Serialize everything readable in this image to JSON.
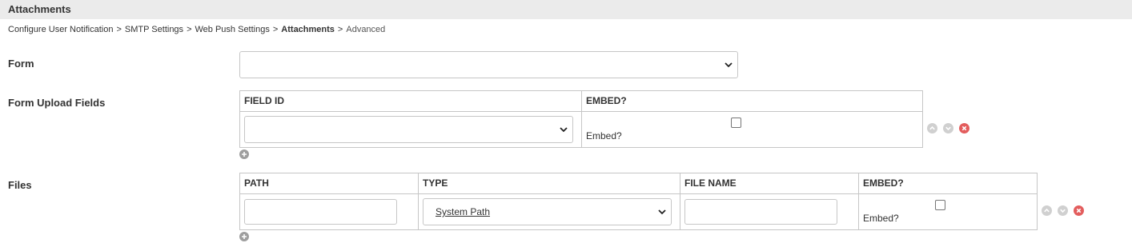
{
  "header": {
    "title": "Attachments"
  },
  "breadcrumb": {
    "items": [
      "Configure User Notification",
      "SMTP Settings",
      "Web Push Settings",
      "Attachments",
      "Advanced"
    ],
    "separator": ">"
  },
  "form_row": {
    "label": "Form",
    "select_value": ""
  },
  "upload_fields": {
    "label": "Form Upload Fields",
    "columns": [
      "FIELD ID",
      "EMBED?"
    ],
    "rows": [
      {
        "field_id": "",
        "embed_label": "Embed?",
        "embed_checked": false
      }
    ]
  },
  "files": {
    "label": "Files",
    "columns": [
      "PATH",
      "TYPE",
      "FILE NAME",
      "EMBED?"
    ],
    "rows": [
      {
        "path": "",
        "type": "System Path",
        "file_name": "",
        "embed_label": "Embed?",
        "embed_checked": false
      }
    ]
  },
  "colors": {
    "header_bg": "#ebebeb",
    "border": "#c6c6c6",
    "icon_gray": "#cfcfcf",
    "icon_red": "#e35d5d",
    "add_icon": "#9e9e9e"
  },
  "icons": {
    "move_up": "chevron-up-circle-icon",
    "move_down": "chevron-down-circle-icon",
    "remove": "close-circle-icon",
    "add": "plus-circle-icon"
  }
}
